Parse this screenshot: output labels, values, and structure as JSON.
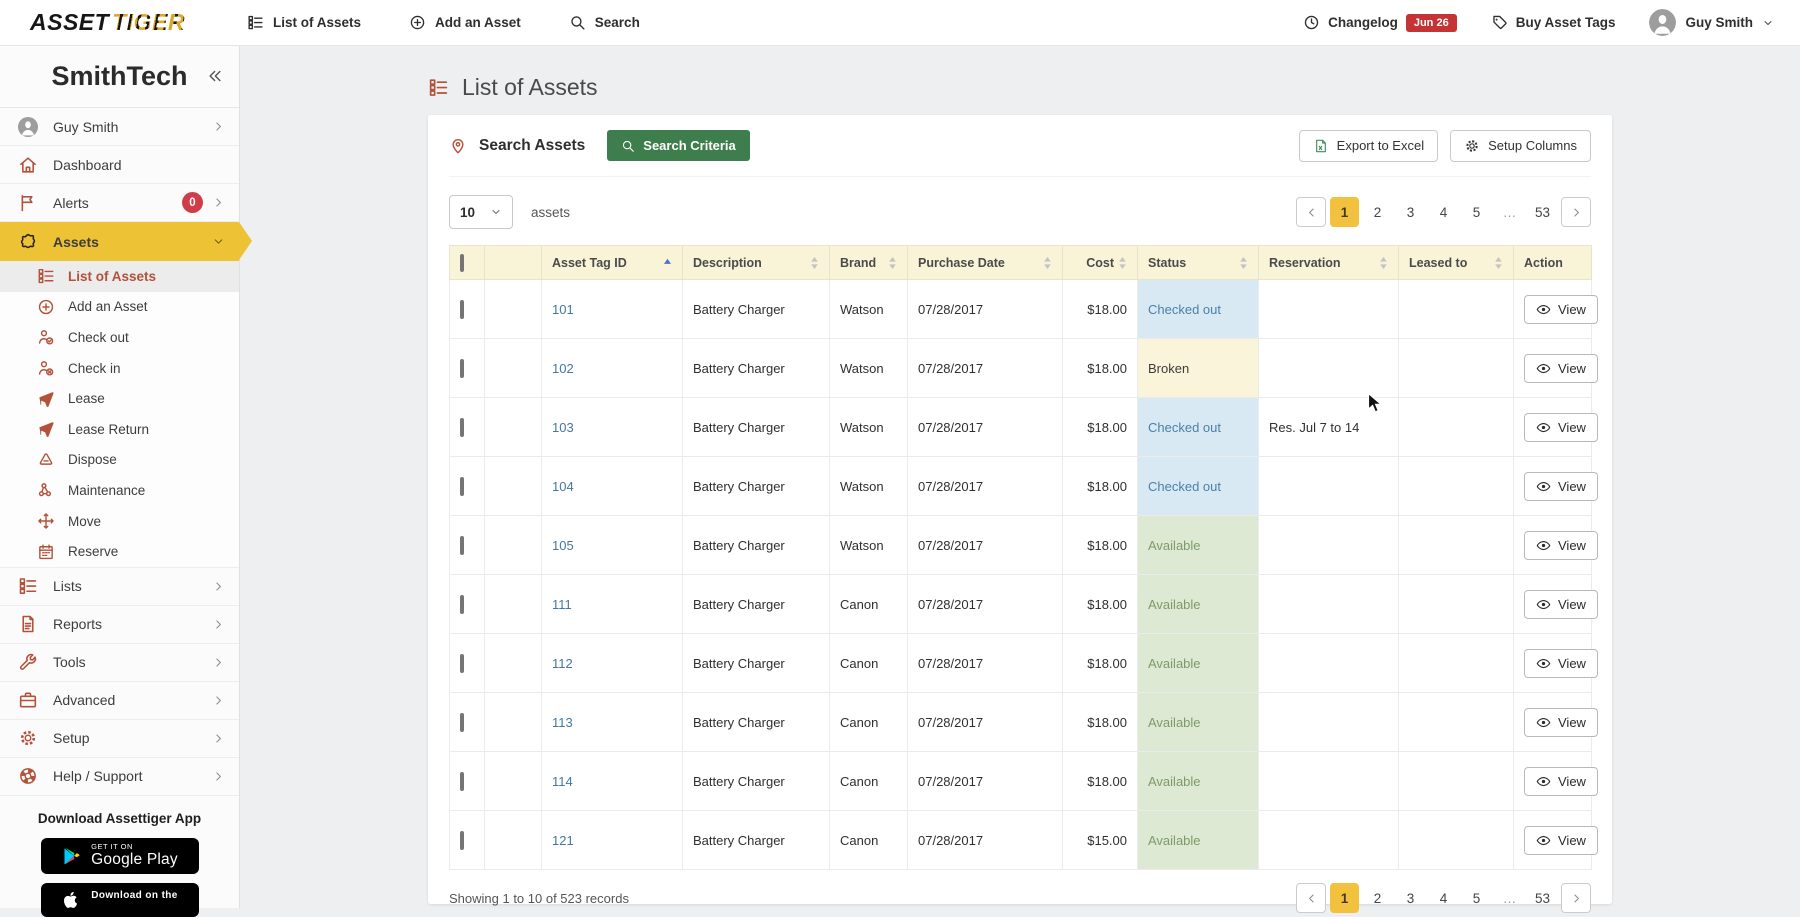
{
  "topbar": {
    "logo": {
      "asset": "ASSET",
      "tiger": "TIGER"
    },
    "nav": [
      {
        "icon": "list",
        "label": "List of Assets"
      },
      {
        "icon": "plus-circle",
        "label": "Add an Asset"
      },
      {
        "icon": "search",
        "label": "Search"
      }
    ],
    "changelog": {
      "label": "Changelog",
      "badge": "Jun 26"
    },
    "buy_asset_tags": "Buy Asset Tags",
    "user": "Guy Smith"
  },
  "sidebar": {
    "company": "SmithTech",
    "items": [
      {
        "icon": "avatar",
        "label": "Guy Smith",
        "chevron": "right"
      },
      {
        "icon": "home",
        "label": "Dashboard"
      },
      {
        "icon": "flag",
        "label": "Alerts",
        "badge": "0",
        "chevron": "right"
      },
      {
        "icon": "asset-blob",
        "label": "Assets",
        "chevron": "down",
        "active": true,
        "submenu": [
          {
            "icon": "list",
            "label": "List of Assets",
            "active": true
          },
          {
            "icon": "plus-circle",
            "label": "Add an Asset"
          },
          {
            "icon": "person-check",
            "label": "Check out"
          },
          {
            "icon": "person-x",
            "label": "Check in"
          },
          {
            "icon": "send",
            "label": "Lease"
          },
          {
            "icon": "send",
            "label": "Lease Return"
          },
          {
            "icon": "recycle",
            "label": "Dispose"
          },
          {
            "icon": "molecule",
            "label": "Maintenance"
          },
          {
            "icon": "move",
            "label": "Move"
          },
          {
            "icon": "calendar",
            "label": "Reserve"
          }
        ]
      },
      {
        "icon": "list",
        "label": "Lists",
        "chevron": "right"
      },
      {
        "icon": "report",
        "label": "Reports",
        "chevron": "right"
      },
      {
        "icon": "wrench",
        "label": "Tools",
        "chevron": "right"
      },
      {
        "icon": "briefcase",
        "label": "Advanced",
        "chevron": "right"
      },
      {
        "icon": "gear",
        "label": "Setup",
        "chevron": "right"
      },
      {
        "icon": "lifebuoy",
        "label": "Help / Support",
        "chevron": "right"
      }
    ],
    "download": {
      "heading": "Download Assettiger App",
      "google_play_top": "GET IT ON",
      "google_play_bottom": "Google Play",
      "app_store_top": "Download on the"
    }
  },
  "main": {
    "page_title": "List of Assets",
    "search": {
      "label": "Search Assets",
      "criteria_button": "Search Criteria"
    },
    "actions": {
      "export": "Export to Excel",
      "setup_columns": "Setup Columns"
    },
    "page_size": "10",
    "page_size_suffix": "assets",
    "pagination": {
      "pages": [
        "1",
        "2",
        "3",
        "4",
        "5",
        "...",
        "53"
      ],
      "active": "1"
    },
    "table": {
      "columns": [
        {
          "label": "Asset Tag ID",
          "sort": "asc"
        },
        {
          "label": "Description",
          "sort": "both"
        },
        {
          "label": "Brand",
          "sort": "both"
        },
        {
          "label": "Purchase Date",
          "sort": "both"
        },
        {
          "label": "Cost",
          "sort": "both",
          "align": "right"
        },
        {
          "label": "Status",
          "sort": "both"
        },
        {
          "label": "Reservation",
          "sort": "both"
        },
        {
          "label": "Leased to",
          "sort": "both"
        },
        {
          "label": "Action",
          "sort": "none"
        }
      ],
      "rows": [
        {
          "id": "101",
          "description": "Battery Charger",
          "brand": "Watson",
          "purchase_date": "07/28/2017",
          "cost": "$18.00",
          "status": "Checked out",
          "reservation": "",
          "leased_to": "",
          "action": "View"
        },
        {
          "id": "102",
          "description": "Battery Charger",
          "brand": "Watson",
          "purchase_date": "07/28/2017",
          "cost": "$18.00",
          "status": "Broken",
          "reservation": "",
          "leased_to": "",
          "action": "View"
        },
        {
          "id": "103",
          "description": "Battery Charger",
          "brand": "Watson",
          "purchase_date": "07/28/2017",
          "cost": "$18.00",
          "status": "Checked out",
          "reservation": "Res. Jul 7 to 14",
          "leased_to": "",
          "action": "View"
        },
        {
          "id": "104",
          "description": "Battery Charger",
          "brand": "Watson",
          "purchase_date": "07/28/2017",
          "cost": "$18.00",
          "status": "Checked out",
          "reservation": "",
          "leased_to": "",
          "action": "View"
        },
        {
          "id": "105",
          "description": "Battery Charger",
          "brand": "Watson",
          "purchase_date": "07/28/2017",
          "cost": "$18.00",
          "status": "Available",
          "reservation": "",
          "leased_to": "",
          "action": "View"
        },
        {
          "id": "111",
          "description": "Battery Charger",
          "brand": "Canon",
          "purchase_date": "07/28/2017",
          "cost": "$18.00",
          "status": "Available",
          "reservation": "",
          "leased_to": "",
          "action": "View"
        },
        {
          "id": "112",
          "description": "Battery Charger",
          "brand": "Canon",
          "purchase_date": "07/28/2017",
          "cost": "$18.00",
          "status": "Available",
          "reservation": "",
          "leased_to": "",
          "action": "View"
        },
        {
          "id": "113",
          "description": "Battery Charger",
          "brand": "Canon",
          "purchase_date": "07/28/2017",
          "cost": "$18.00",
          "status": "Available",
          "reservation": "",
          "leased_to": "",
          "action": "View"
        },
        {
          "id": "114",
          "description": "Battery Charger",
          "brand": "Canon",
          "purchase_date": "07/28/2017",
          "cost": "$18.00",
          "status": "Available",
          "reservation": "",
          "leased_to": "",
          "action": "View"
        },
        {
          "id": "121",
          "description": "Battery Charger",
          "brand": "Canon",
          "purchase_date": "07/28/2017",
          "cost": "$15.00",
          "status": "Available",
          "reservation": "",
          "leased_to": "",
          "action": "View"
        }
      ]
    },
    "footer": {
      "showing": "Showing 1 to 10 of 523 records"
    }
  },
  "colors": {
    "accent_yellow": "#eec235",
    "sidebar_icon_red": "#b3523a",
    "green_button": "#3e7d4c",
    "link_blue": "#4577a0",
    "badge_red": "#c43434",
    "status": {
      "Checked out": {
        "bg": "#d9e9f4",
        "fg": "#4a80a8"
      },
      "Broken": {
        "bg": "#faf4da",
        "fg": "#3c3c3c"
      },
      "Available": {
        "bg": "#dde9d2",
        "fg": "#7d9b6a"
      }
    }
  }
}
